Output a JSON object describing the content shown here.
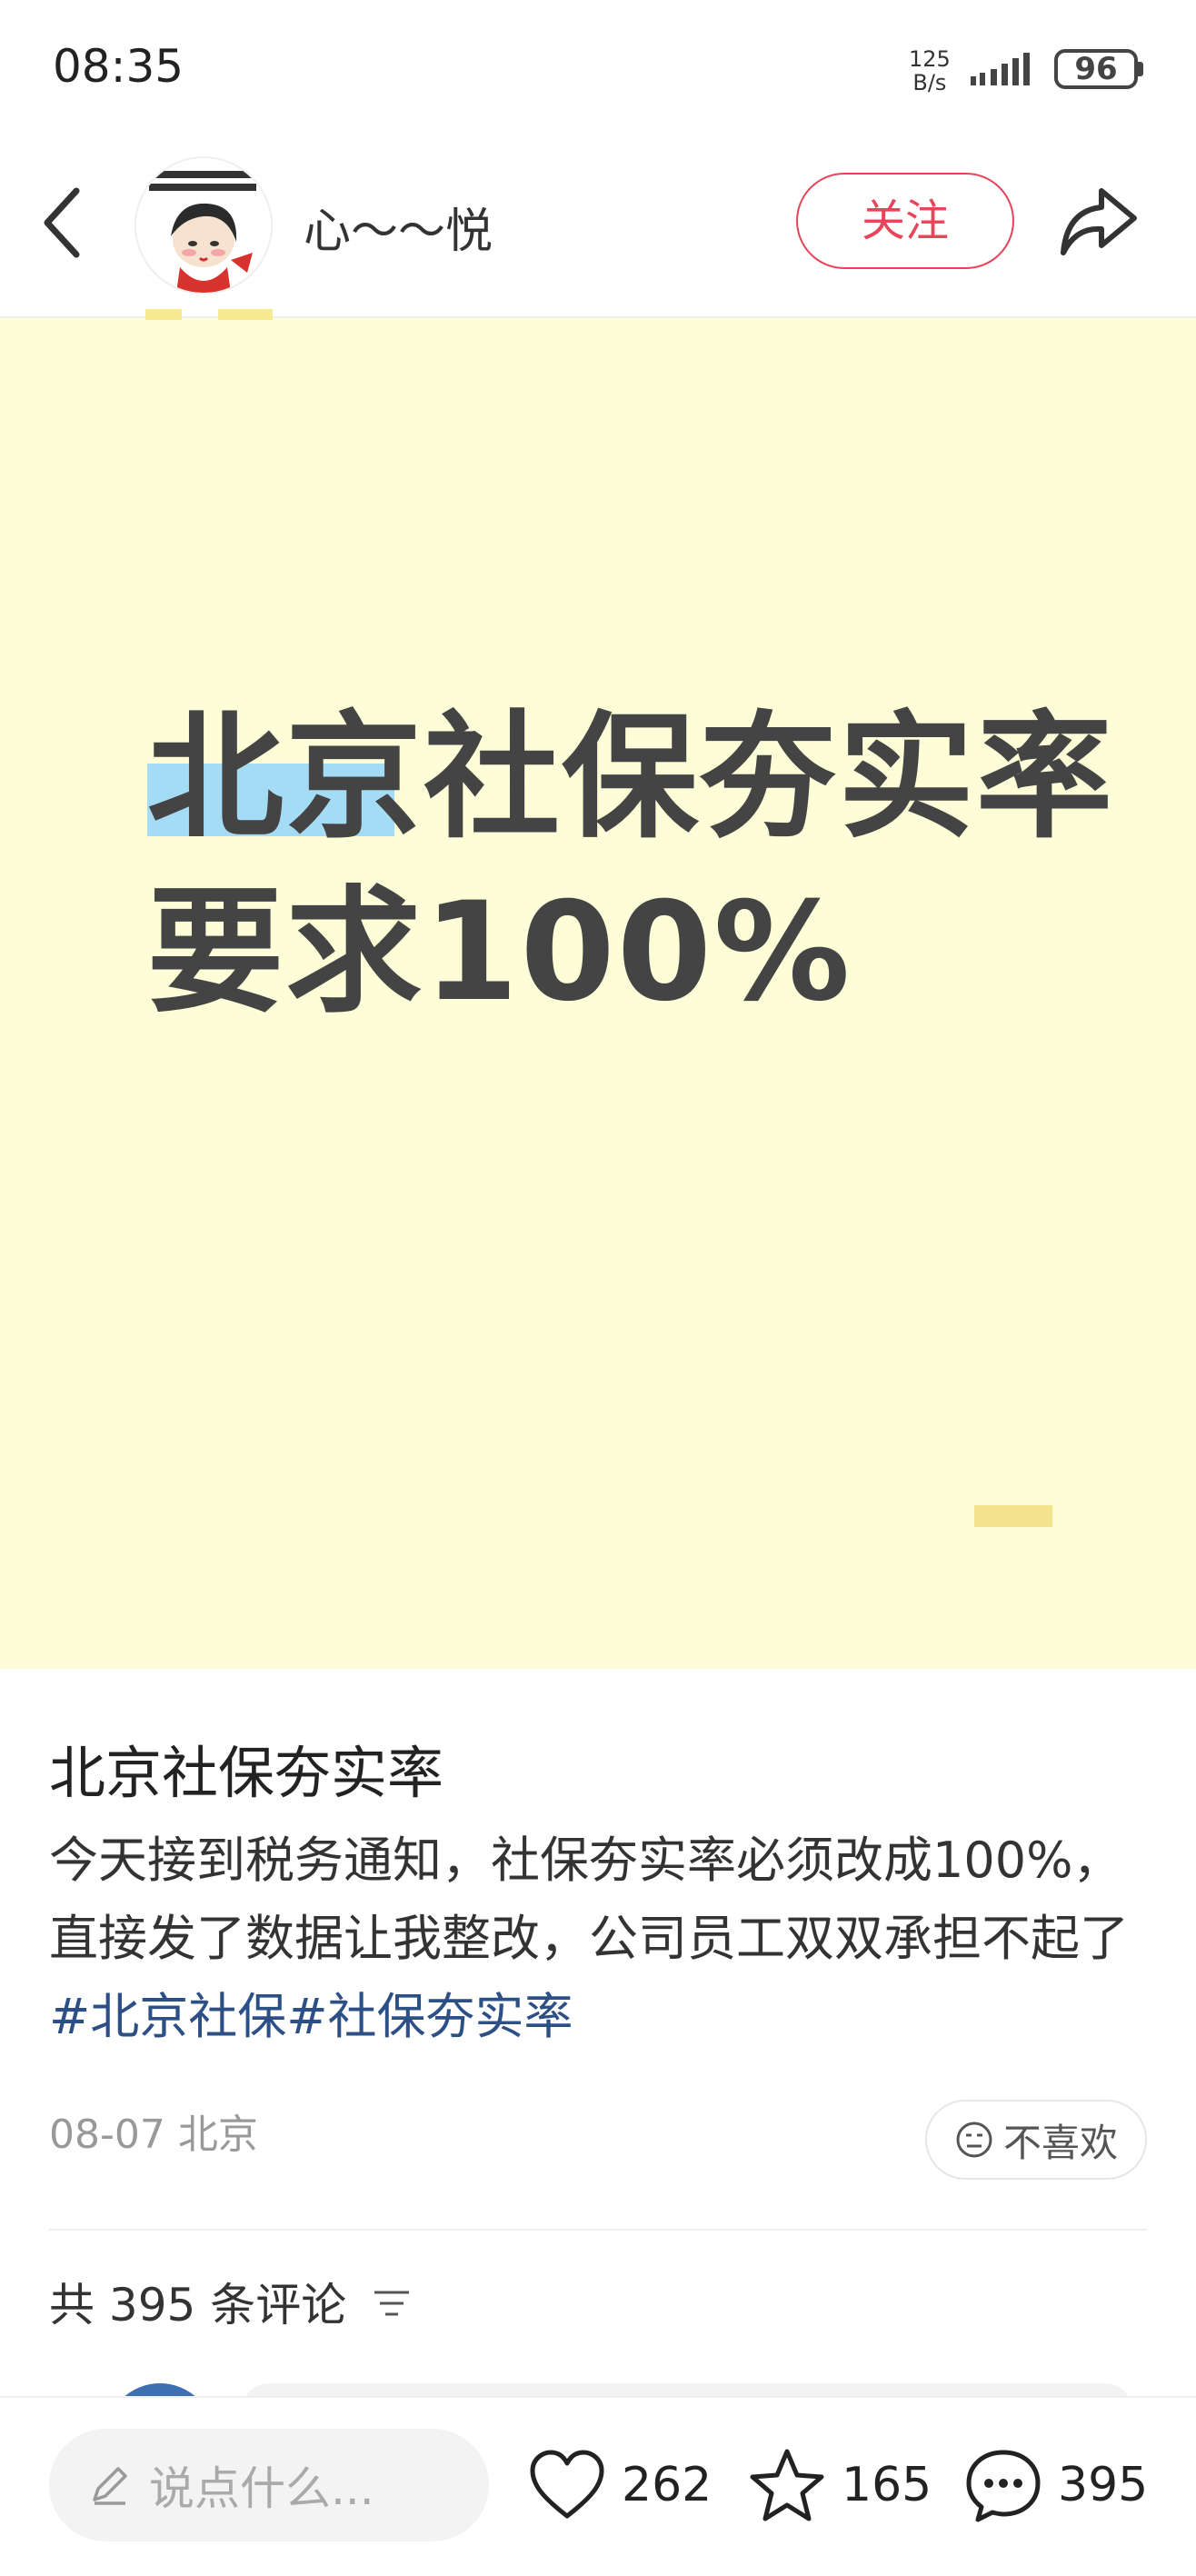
{
  "status_bar": {
    "time": "08:35",
    "net_speed_value": "125",
    "net_speed_unit": "B/s",
    "battery": "96"
  },
  "header": {
    "username": "心～～悦",
    "follow_label": "关注"
  },
  "image_card": {
    "line1": "北京社保夯实率",
    "line2": "要求100%",
    "background": "#fdfdd7",
    "highlight": "#a5dcf5"
  },
  "post": {
    "title": "北京社保夯实率",
    "body_text": "今天接到税务通知，社保夯实率必须改成100%，直接发了数据让我整改，公司员工双双承担不起了",
    "tag1": "#北京社保",
    "tag2": "#社保夯实率",
    "date_location": "08-07 北京",
    "dislike_label": "不喜欢"
  },
  "comments": {
    "count_label": "共 395 条评论"
  },
  "bottom_bar": {
    "input_placeholder": "说点什么...",
    "likes": "262",
    "favorites": "165",
    "comments": "395"
  },
  "colors": {
    "accent": "#e8445a",
    "tag": "#2c4f86"
  }
}
